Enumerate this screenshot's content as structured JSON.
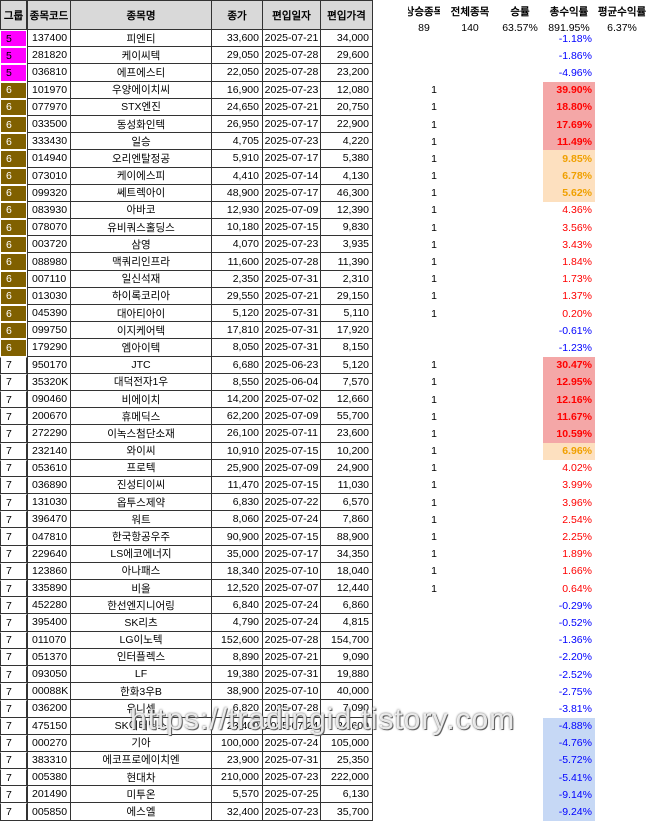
{
  "headers": {
    "group": "그룹",
    "code": "종목코드",
    "name": "종목명",
    "price": "종가",
    "date": "편입일자",
    "iprice": "편입가격",
    "up": "상승종목",
    "total": "전체종목",
    "winrate": "승률",
    "totalret": "총수익률",
    "avgret": "평균수익률"
  },
  "summary": {
    "up": "89",
    "total": "140",
    "winrate": "63.57%",
    "totalret": "891.95%",
    "avgret": "6.37%"
  },
  "colors": {
    "group5": "#ff00ff",
    "group6": "#806000",
    "group7": "#ffffff",
    "red_strong": "#f4a7a7",
    "orange": "#fde0bf",
    "blue": "#c6d8f5"
  },
  "rows": [
    {
      "g": "5",
      "code": "137400",
      "name": "피엔티",
      "price": "33,600",
      "date": "2025-07-21",
      "iprice": "34,000",
      "up": "",
      "ret": "-1.18%",
      "hl": ""
    },
    {
      "g": "5",
      "code": "281820",
      "name": "케이씨텍",
      "price": "29,050",
      "date": "2025-07-28",
      "iprice": "29,600",
      "up": "",
      "ret": "-1.86%",
      "hl": ""
    },
    {
      "g": "5",
      "code": "036810",
      "name": "에프에스티",
      "price": "22,050",
      "date": "2025-07-28",
      "iprice": "23,200",
      "up": "",
      "ret": "-4.96%",
      "hl": ""
    },
    {
      "g": "6",
      "code": "101970",
      "name": "우양에이치씨",
      "price": "16,900",
      "date": "2025-07-23",
      "iprice": "12,080",
      "up": "1",
      "ret": "39.90%",
      "hl": "red"
    },
    {
      "g": "6",
      "code": "077970",
      "name": "STX엔진",
      "price": "24,650",
      "date": "2025-07-21",
      "iprice": "20,750",
      "up": "1",
      "ret": "18.80%",
      "hl": "red"
    },
    {
      "g": "6",
      "code": "033500",
      "name": "동성화인텍",
      "price": "26,950",
      "date": "2025-07-17",
      "iprice": "22,900",
      "up": "1",
      "ret": "17.69%",
      "hl": "red"
    },
    {
      "g": "6",
      "code": "333430",
      "name": "일승",
      "price": "4,705",
      "date": "2025-07-23",
      "iprice": "4,220",
      "up": "1",
      "ret": "11.49%",
      "hl": "red"
    },
    {
      "g": "6",
      "code": "014940",
      "name": "오리엔탈정공",
      "price": "5,910",
      "date": "2025-07-17",
      "iprice": "5,380",
      "up": "1",
      "ret": "9.85%",
      "hl": "orange"
    },
    {
      "g": "6",
      "code": "073010",
      "name": "케이에스피",
      "price": "4,410",
      "date": "2025-07-14",
      "iprice": "4,130",
      "up": "1",
      "ret": "6.78%",
      "hl": "orange"
    },
    {
      "g": "6",
      "code": "099320",
      "name": "쎄트렉아이",
      "price": "48,900",
      "date": "2025-07-17",
      "iprice": "46,300",
      "up": "1",
      "ret": "5.62%",
      "hl": "orange"
    },
    {
      "g": "6",
      "code": "083930",
      "name": "아바코",
      "price": "12,930",
      "date": "2025-07-09",
      "iprice": "12,390",
      "up": "1",
      "ret": "4.36%",
      "hl": ""
    },
    {
      "g": "6",
      "code": "078070",
      "name": "유비쿼스홀딩스",
      "price": "10,180",
      "date": "2025-07-15",
      "iprice": "9,830",
      "up": "1",
      "ret": "3.56%",
      "hl": ""
    },
    {
      "g": "6",
      "code": "003720",
      "name": "삼영",
      "price": "4,070",
      "date": "2025-07-23",
      "iprice": "3,935",
      "up": "1",
      "ret": "3.43%",
      "hl": ""
    },
    {
      "g": "6",
      "code": "088980",
      "name": "맥쿼리인프라",
      "price": "11,600",
      "date": "2025-07-28",
      "iprice": "11,390",
      "up": "1",
      "ret": "1.84%",
      "hl": ""
    },
    {
      "g": "6",
      "code": "007110",
      "name": "일신석재",
      "price": "2,350",
      "date": "2025-07-31",
      "iprice": "2,310",
      "up": "1",
      "ret": "1.73%",
      "hl": ""
    },
    {
      "g": "6",
      "code": "013030",
      "name": "하이록코리아",
      "price": "29,550",
      "date": "2025-07-21",
      "iprice": "29,150",
      "up": "1",
      "ret": "1.37%",
      "hl": ""
    },
    {
      "g": "6",
      "code": "045390",
      "name": "대아티아이",
      "price": "5,120",
      "date": "2025-07-31",
      "iprice": "5,110",
      "up": "1",
      "ret": "0.20%",
      "hl": ""
    },
    {
      "g": "6",
      "code": "099750",
      "name": "이지케어텍",
      "price": "17,810",
      "date": "2025-07-31",
      "iprice": "17,920",
      "up": "",
      "ret": "-0.61%",
      "hl": ""
    },
    {
      "g": "6",
      "code": "179290",
      "name": "엠아이텍",
      "price": "8,050",
      "date": "2025-07-31",
      "iprice": "8,150",
      "up": "",
      "ret": "-1.23%",
      "hl": ""
    },
    {
      "g": "7",
      "code": "950170",
      "name": "JTC",
      "price": "6,680",
      "date": "2025-06-23",
      "iprice": "5,120",
      "up": "1",
      "ret": "30.47%",
      "hl": "red"
    },
    {
      "g": "7",
      "code": "35320K",
      "name": "대덕전자1우",
      "price": "8,550",
      "date": "2025-06-04",
      "iprice": "7,570",
      "up": "1",
      "ret": "12.95%",
      "hl": "red"
    },
    {
      "g": "7",
      "code": "090460",
      "name": "비에이치",
      "price": "14,200",
      "date": "2025-07-02",
      "iprice": "12,660",
      "up": "1",
      "ret": "12.16%",
      "hl": "red"
    },
    {
      "g": "7",
      "code": "200670",
      "name": "휴메딕스",
      "price": "62,200",
      "date": "2025-07-09",
      "iprice": "55,700",
      "up": "1",
      "ret": "11.67%",
      "hl": "red"
    },
    {
      "g": "7",
      "code": "272290",
      "name": "이녹스첨단소재",
      "price": "26,100",
      "date": "2025-07-11",
      "iprice": "23,600",
      "up": "1",
      "ret": "10.59%",
      "hl": "red"
    },
    {
      "g": "7",
      "code": "232140",
      "name": "와이씨",
      "price": "10,910",
      "date": "2025-07-15",
      "iprice": "10,200",
      "up": "1",
      "ret": "6.96%",
      "hl": "orange"
    },
    {
      "g": "7",
      "code": "053610",
      "name": "프로텍",
      "price": "25,900",
      "date": "2025-07-09",
      "iprice": "24,900",
      "up": "1",
      "ret": "4.02%",
      "hl": ""
    },
    {
      "g": "7",
      "code": "036890",
      "name": "진성티이씨",
      "price": "11,470",
      "date": "2025-07-15",
      "iprice": "11,030",
      "up": "1",
      "ret": "3.99%",
      "hl": ""
    },
    {
      "g": "7",
      "code": "131030",
      "name": "옵투스제약",
      "price": "6,830",
      "date": "2025-07-22",
      "iprice": "6,570",
      "up": "1",
      "ret": "3.96%",
      "hl": ""
    },
    {
      "g": "7",
      "code": "396470",
      "name": "워트",
      "price": "8,060",
      "date": "2025-07-24",
      "iprice": "7,860",
      "up": "1",
      "ret": "2.54%",
      "hl": ""
    },
    {
      "g": "7",
      "code": "047810",
      "name": "한국항공우주",
      "price": "90,900",
      "date": "2025-07-15",
      "iprice": "88,900",
      "up": "1",
      "ret": "2.25%",
      "hl": ""
    },
    {
      "g": "7",
      "code": "229640",
      "name": "LS에코에너지",
      "price": "35,000",
      "date": "2025-07-17",
      "iprice": "34,350",
      "up": "1",
      "ret": "1.89%",
      "hl": ""
    },
    {
      "g": "7",
      "code": "123860",
      "name": "아나패스",
      "price": "18,340",
      "date": "2025-07-10",
      "iprice": "18,040",
      "up": "1",
      "ret": "1.66%",
      "hl": ""
    },
    {
      "g": "7",
      "code": "335890",
      "name": "비올",
      "price": "12,520",
      "date": "2025-07-07",
      "iprice": "12,440",
      "up": "1",
      "ret": "0.64%",
      "hl": ""
    },
    {
      "g": "7",
      "code": "452280",
      "name": "한선엔지니어링",
      "price": "6,840",
      "date": "2025-07-24",
      "iprice": "6,860",
      "up": "",
      "ret": "-0.29%",
      "hl": ""
    },
    {
      "g": "7",
      "code": "395400",
      "name": "SK리츠",
      "price": "4,790",
      "date": "2025-07-24",
      "iprice": "4,815",
      "up": "",
      "ret": "-0.52%",
      "hl": ""
    },
    {
      "g": "7",
      "code": "011070",
      "name": "LG이노텍",
      "price": "152,600",
      "date": "2025-07-28",
      "iprice": "154,700",
      "up": "",
      "ret": "-1.36%",
      "hl": ""
    },
    {
      "g": "7",
      "code": "051370",
      "name": "인터플렉스",
      "price": "8,890",
      "date": "2025-07-21",
      "iprice": "9,090",
      "up": "",
      "ret": "-2.20%",
      "hl": ""
    },
    {
      "g": "7",
      "code": "093050",
      "name": "LF",
      "price": "19,380",
      "date": "2025-07-31",
      "iprice": "19,880",
      "up": "",
      "ret": "-2.52%",
      "hl": ""
    },
    {
      "g": "7",
      "code": "00088K",
      "name": "한화3우B",
      "price": "38,900",
      "date": "2025-07-10",
      "iprice": "40,000",
      "up": "",
      "ret": "-2.75%",
      "hl": ""
    },
    {
      "g": "7",
      "code": "036200",
      "name": "유니셈",
      "price": "6,820",
      "date": "2025-07-28",
      "iprice": "7,090",
      "up": "",
      "ret": "-3.81%",
      "hl": ""
    },
    {
      "g": "7",
      "code": "475150",
      "name": "SK이터닉스",
      "price": "23,400",
      "date": "2025-07-24",
      "iprice": "24,600",
      "up": "",
      "ret": "-4.88%",
      "hl": "blue"
    },
    {
      "g": "7",
      "code": "000270",
      "name": "기아",
      "price": "100,000",
      "date": "2025-07-24",
      "iprice": "105,000",
      "up": "",
      "ret": "-4.76%",
      "hl": "blue"
    },
    {
      "g": "7",
      "code": "383310",
      "name": "에코프로에이치엔",
      "price": "23,900",
      "date": "2025-07-31",
      "iprice": "25,350",
      "up": "",
      "ret": "-5.72%",
      "hl": "blue"
    },
    {
      "g": "7",
      "code": "005380",
      "name": "현대차",
      "price": "210,000",
      "date": "2025-07-23",
      "iprice": "222,000",
      "up": "",
      "ret": "-5.41%",
      "hl": "blue"
    },
    {
      "g": "7",
      "code": "201490",
      "name": "미투온",
      "price": "5,570",
      "date": "2025-07-25",
      "iprice": "6,130",
      "up": "",
      "ret": "-9.14%",
      "hl": "blue"
    },
    {
      "g": "7",
      "code": "005850",
      "name": "에스엘",
      "price": "32,400",
      "date": "2025-07-23",
      "iprice": "35,700",
      "up": "",
      "ret": "-9.24%",
      "hl": "blue"
    }
  ],
  "watermark": "https://tradingid.tistory.com"
}
